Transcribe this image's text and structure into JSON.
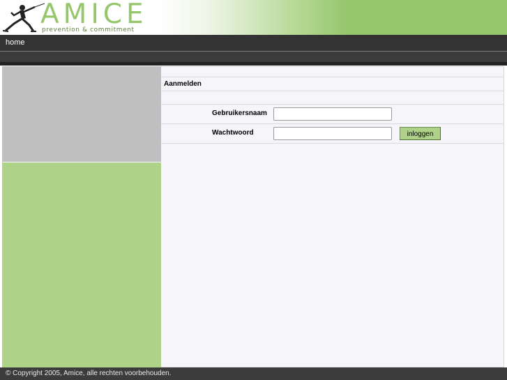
{
  "brand": {
    "name": "AMICE",
    "tagline": "prevention & commitment",
    "accent_color": "#96c66b"
  },
  "nav": {
    "items": [
      {
        "label": "home"
      }
    ]
  },
  "login": {
    "title": "Aanmelden",
    "username_label": "Gebruikersnaam",
    "username_value": "",
    "password_label": "Wachtwoord",
    "password_value": "",
    "submit_label": "inloggen"
  },
  "footer": {
    "copyright": "© Copyright 2005, Amice, alle rechten voorbehouden."
  },
  "colors": {
    "nav_bg": "#333333",
    "sidebar_gray": "#bfbfbf",
    "sidebar_green": "#aed287",
    "content_bg": "#f6f6fa"
  }
}
